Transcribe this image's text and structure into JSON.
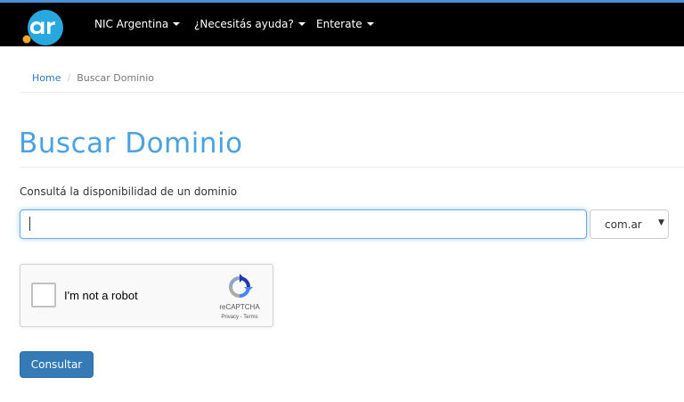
{
  "header": {
    "logo_text": ".ar",
    "nav_items": [
      {
        "label": "NIC Argentina",
        "icon": "caret-down-icon"
      },
      {
        "label": "¿Necesitás ayuda?",
        "icon": "caret-down-icon"
      },
      {
        "label": "Enterate",
        "icon": "caret-down-icon"
      }
    ]
  },
  "breadcrumb": {
    "home": "Home",
    "separator": "/",
    "current": "Buscar Dominio"
  },
  "page": {
    "title": "Buscar Dominio",
    "label": "Consultá la disponibilidad de un dominio"
  },
  "search": {
    "value": "",
    "tld_selected": "com.ar"
  },
  "recaptcha": {
    "label": "I'm not a robot",
    "brand": "reCAPTCHA",
    "terms": "Privacy - Terms",
    "checked": false
  },
  "actions": {
    "submit_label": "Consultar"
  },
  "colors": {
    "navbar": "#000000",
    "accent": "#4a90d9",
    "title": "#4aa3df",
    "link": "#2a7bbf",
    "button": "#337ab7"
  }
}
